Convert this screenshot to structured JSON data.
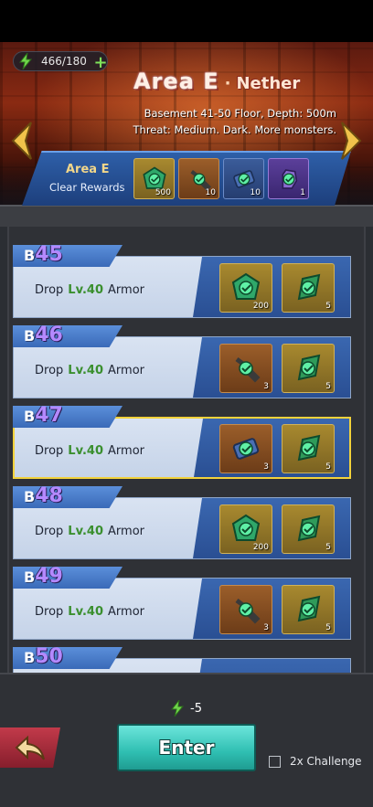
{
  "header": {
    "energy": "466/180",
    "area_title": "Area E",
    "area_separator": "·",
    "area_subtitle": "Nether",
    "area_desc_line1": "Basement 41-50 Floor, Depth: 500m",
    "area_desc_line2": "Threat: Medium. Dark. More monsters."
  },
  "clear": {
    "area_label": "Area E",
    "rewards_label": "Clear Rewards",
    "rewards": [
      {
        "icon": "green-gem-icon",
        "qty": "500"
      },
      {
        "icon": "wrench-icon",
        "qty": "10"
      },
      {
        "icon": "scroll-icon",
        "qty": "10"
      },
      {
        "icon": "glove-icon",
        "qty": "1"
      }
    ]
  },
  "floors": [
    {
      "prefix": "B",
      "number": "45",
      "drop": "Drop",
      "level": "Lv.40",
      "item": "Armor",
      "rewards": [
        {
          "icon": "green-gem-icon",
          "qty": "200"
        },
        {
          "icon": "green-shard-icon",
          "qty": "5"
        }
      ]
    },
    {
      "prefix": "B",
      "number": "46",
      "drop": "Drop",
      "level": "Lv.40",
      "item": "Armor",
      "rewards": [
        {
          "icon": "wrench-icon",
          "qty": "3"
        },
        {
          "icon": "green-shard-icon",
          "qty": "5"
        }
      ]
    },
    {
      "prefix": "B",
      "number": "47",
      "drop": "Drop",
      "level": "Lv.40",
      "item": "Armor",
      "rewards": [
        {
          "icon": "scroll-icon",
          "qty": "3"
        },
        {
          "icon": "green-shard-icon",
          "qty": "5"
        }
      ]
    },
    {
      "prefix": "B",
      "number": "48",
      "drop": "Drop",
      "level": "Lv.40",
      "item": "Armor",
      "rewards": [
        {
          "icon": "green-gem-icon",
          "qty": "200"
        },
        {
          "icon": "green-shard-icon",
          "qty": "5"
        }
      ]
    },
    {
      "prefix": "B",
      "number": "49",
      "drop": "Drop",
      "level": "Lv.40",
      "item": "Armor",
      "rewards": [
        {
          "icon": "wrench-icon",
          "qty": "3"
        },
        {
          "icon": "green-shard-icon",
          "qty": "5"
        }
      ]
    },
    {
      "prefix": "B",
      "number": "50",
      "drop": "",
      "level": "",
      "item": "",
      "rewards": []
    }
  ],
  "footer": {
    "cost": "-5",
    "enter_label": "Enter",
    "challenge_label": "2x Challenge"
  },
  "colors": {
    "accent_teal": "#2fbfb2",
    "selected_border": "#f2d23b",
    "floor_number": "#b489ff",
    "level_green": "#3a8f2e"
  }
}
